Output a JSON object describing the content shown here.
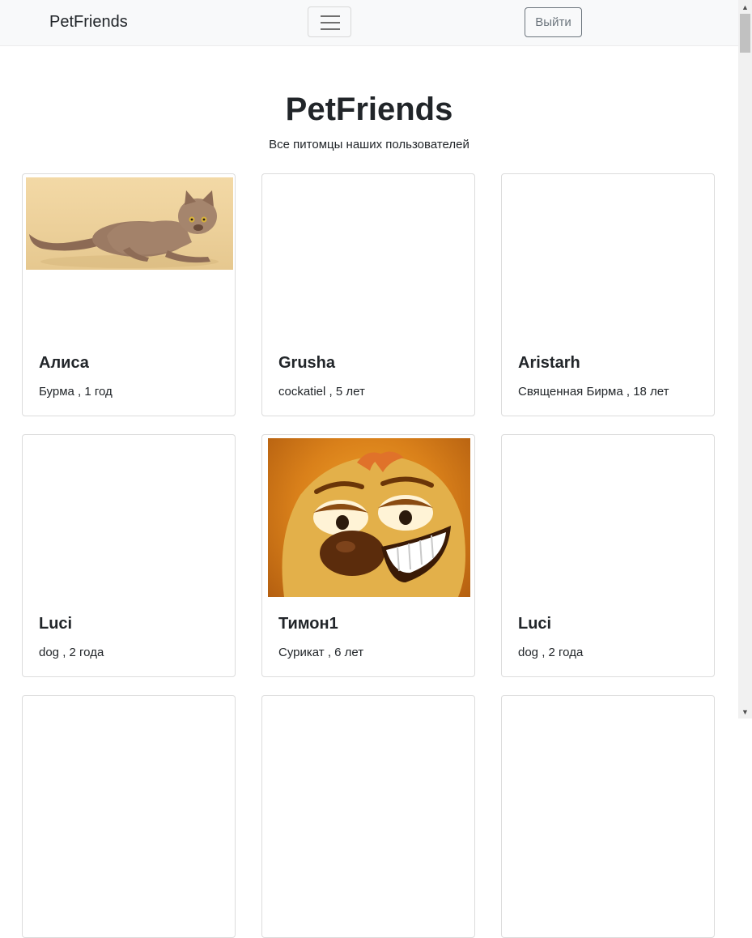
{
  "navbar": {
    "brand": "PetFriends",
    "toggler_icon": "hamburger-menu-icon",
    "logout_label": "Выйти"
  },
  "header": {
    "title": "PetFriends",
    "subtitle": "Все питомцы наших пользователей"
  },
  "pets": [
    {
      "name": "Алиса",
      "info": "Бурма , 1 год",
      "photo": "cat"
    },
    {
      "name": "Grusha",
      "info": "cockatiel , 5 лет",
      "photo": ""
    },
    {
      "name": "Aristarh",
      "info": "Священная Бирма , 18 лет",
      "photo": ""
    },
    {
      "name": "Luci",
      "info": "dog , 2 года",
      "photo": ""
    },
    {
      "name": "Тимон1",
      "info": "Сурикат , 6 лет",
      "photo": "meerkat"
    },
    {
      "name": "Luci",
      "info": "dog , 2 года",
      "photo": ""
    }
  ],
  "colors": {
    "navbar_bg": "#f8f9fa",
    "text": "#212529",
    "logout_border": "#6c757d",
    "card_border": "#dcdcdc"
  }
}
